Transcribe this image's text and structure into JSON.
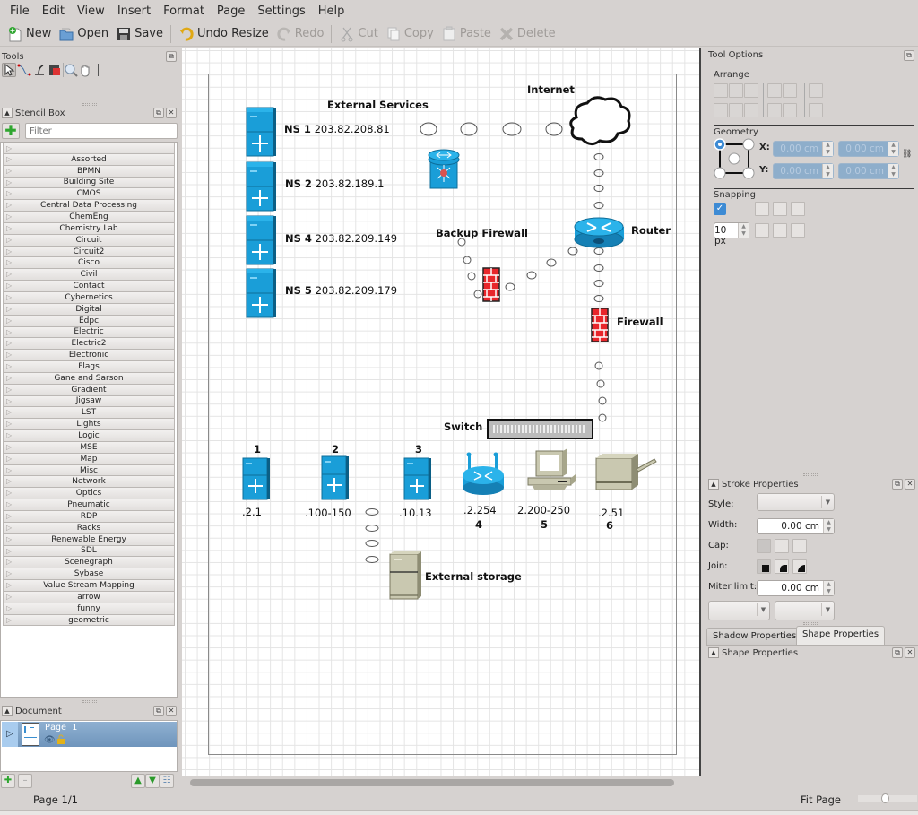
{
  "menu": [
    "File",
    "Edit",
    "View",
    "Insert",
    "Format",
    "Page",
    "Settings",
    "Help"
  ],
  "toolbar": {
    "new": "New",
    "open": "Open",
    "save": "Save",
    "undo": "Undo Resize",
    "redo": "Redo",
    "cut": "Cut",
    "copy": "Copy",
    "paste": "Paste",
    "delete": "Delete"
  },
  "tools_panel": {
    "title": "Tools"
  },
  "stencil_box": {
    "title": "Stencil Box",
    "filter_placeholder": "Filter",
    "items": [
      "",
      "Assorted",
      "BPMN",
      "Building Site",
      "CMOS",
      "Central Data Processing",
      "ChemEng",
      "Chemistry Lab",
      "Circuit",
      "Circuit2",
      "Cisco",
      "Civil",
      "Contact",
      "Cybernetics",
      "Digital",
      "Edpc",
      "Electric",
      "Electric2",
      "Electronic",
      "Flags",
      "Gane and Sarson",
      "Gradient",
      "Jigsaw",
      "LST",
      "Lights",
      "Logic",
      "MSE",
      "Map",
      "Misc",
      "Network",
      "Optics",
      "Pneumatic",
      "RDP",
      "Racks",
      "Renewable Energy",
      "SDL",
      "Scenegraph",
      "Sybase",
      "Value Stream Mapping",
      "arrow",
      "funny",
      "geometric"
    ]
  },
  "document_panel": {
    "title": "Document",
    "page_name": "Page  1"
  },
  "diagram": {
    "external_services": "External Services",
    "internet": "Internet",
    "ns": [
      {
        "name": "NS 1",
        "ip": "203.82.208.81"
      },
      {
        "name": "NS 2",
        "ip": "203.82.189.1"
      },
      {
        "name": "NS 4",
        "ip": "203.82.209.149"
      },
      {
        "name": "NS 5",
        "ip": "203.82.209.179"
      }
    ],
    "backup_firewall": "Backup Firewall",
    "router": "Router",
    "firewall": "Firewall",
    "switch": "Switch",
    "external_storage": "External storage",
    "nodes": [
      {
        "num": "1",
        "ip": ".2.1"
      },
      {
        "num": "2",
        "ip": ".100-150"
      },
      {
        "num": "3",
        "ip": ".10.13"
      },
      {
        "num": "4",
        "ip": ".2.254"
      },
      {
        "num": "5",
        "ip": "2.200-250"
      },
      {
        "num": "6",
        "ip": ".2.51"
      }
    ]
  },
  "tool_options": {
    "title": "Tool Options",
    "arrange": "Arrange",
    "geometry": "Geometry",
    "x_label": "X:",
    "y_label": "Y:",
    "x_value": "0.00 cm",
    "y_value": "0.00 cm",
    "w_value": "0.00 cm",
    "h_value": "0.00 cm",
    "snapping": "Snapping",
    "snap_enabled": true,
    "snap_distance": "10 px"
  },
  "stroke_properties": {
    "title": "Stroke Properties",
    "style_label": "Style:",
    "width_label": "Width:",
    "width_value": "0.00 cm",
    "cap_label": "Cap:",
    "join_label": "Join:",
    "miter_label": "Miter limit:",
    "miter_value": "0.00 cm"
  },
  "tabs": {
    "shadow": "Shadow Properties",
    "shape": "Shape Properties"
  },
  "shape_properties": {
    "title": "Shape Properties"
  },
  "status": {
    "page": "Page 1/1",
    "zoom": "Fit Page"
  }
}
